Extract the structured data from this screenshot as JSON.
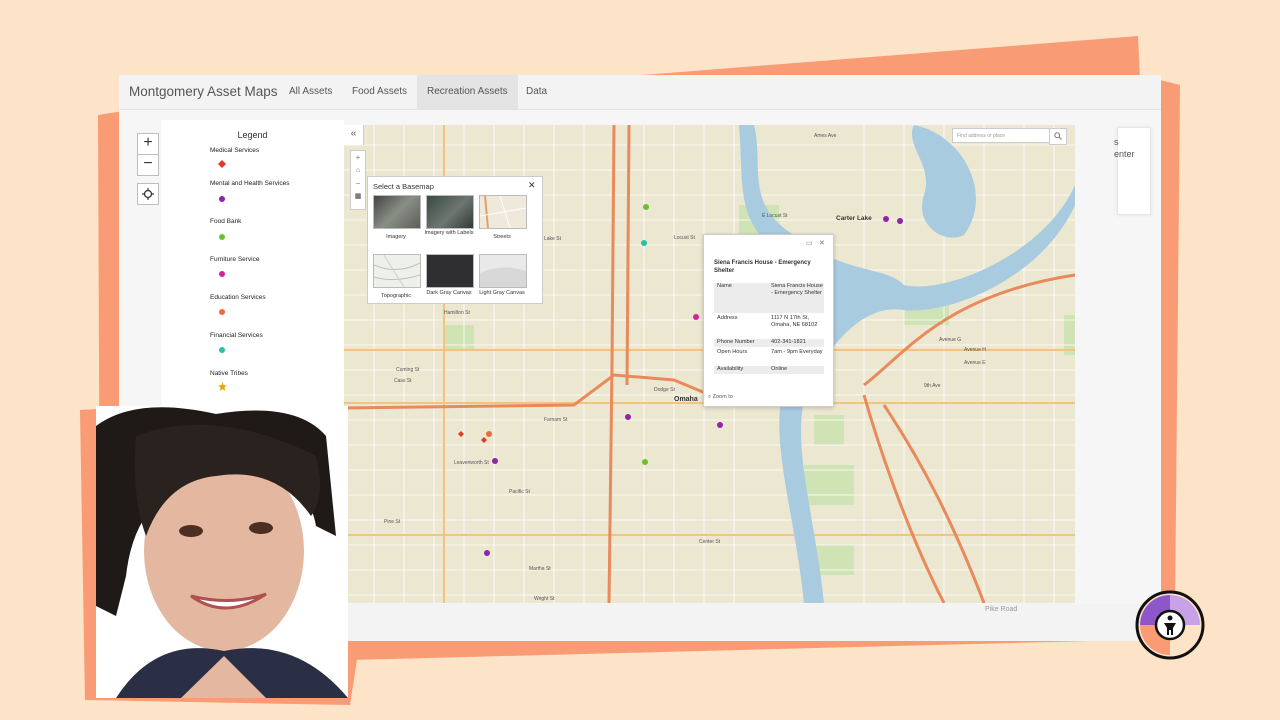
{
  "app": {
    "title": "Montgomery Asset Maps",
    "tabs": [
      {
        "label": "All Assets",
        "active": false
      },
      {
        "label": "Food Assets",
        "active": false
      },
      {
        "label": "Recreation Assets",
        "active": true
      },
      {
        "label": "Data",
        "active": false
      }
    ]
  },
  "side_card_fragment": [
    "s",
    "enter"
  ],
  "map_controls": {
    "zoom_in": "+",
    "zoom_out": "−",
    "locate_icon": "crosshair-icon"
  },
  "legend": {
    "title": "Legend",
    "items": [
      {
        "label": "Medical Services",
        "color": "#e0392b",
        "shape": "diamond"
      },
      {
        "label": "Mental and Health Services",
        "color": "#8e24aa",
        "shape": "circle"
      },
      {
        "label": "Food Bank",
        "color": "#6cbf2e",
        "shape": "circle"
      },
      {
        "label": "Furniture Service",
        "color": "#d6219a",
        "shape": "circle"
      },
      {
        "label": "Education Services",
        "color": "#ec6a3c",
        "shape": "circle"
      },
      {
        "label": "Financial Services",
        "color": "#27c1a5",
        "shape": "circle"
      },
      {
        "label": "Native Tribes",
        "color": "#e5a400",
        "shape": "star"
      }
    ]
  },
  "map": {
    "collapse_icon": "double-chevron-left-icon",
    "search_placeholder": "Find address or place",
    "labels": {
      "city": "Omaha",
      "carter_lake": "Carter Lake",
      "bottom_road": "Pike Road",
      "streets": [
        "Cuming St",
        "Leavenworth St",
        "Dodge St",
        "Farnam St",
        "Cass St",
        "Hamilton St",
        "Lake St",
        "Ames Ave",
        "Center St",
        "Pacific St",
        "Pine St",
        "Martha St",
        "Wright St",
        "Locust St",
        "Avenue G",
        "Avenue H",
        "Avenue E",
        "9th Ave",
        "E Locust St"
      ]
    }
  },
  "basemap_gallery": {
    "title": "Select a Basemap",
    "options": [
      "Imagery",
      "Imagery with Labels",
      "Streets",
      "Topographic",
      "Dark Gray Canvas",
      "Light Gray Canvas"
    ]
  },
  "popup": {
    "title": "Siena Francis House - Emergency Shelter",
    "fields": [
      {
        "key": "Name",
        "value": "Siena Francis House - Emergency Shelter"
      },
      {
        "key": "Address",
        "value": "1117 N 17th St, Omaha, NE 68102"
      },
      {
        "key": "Phone Number",
        "value": "402-341-1821"
      },
      {
        "key": "Open Hours",
        "value": "7am - 9pm Everyday"
      },
      {
        "key": "Availability",
        "value": "Online"
      }
    ],
    "zoom_to": "Zoom to"
  }
}
